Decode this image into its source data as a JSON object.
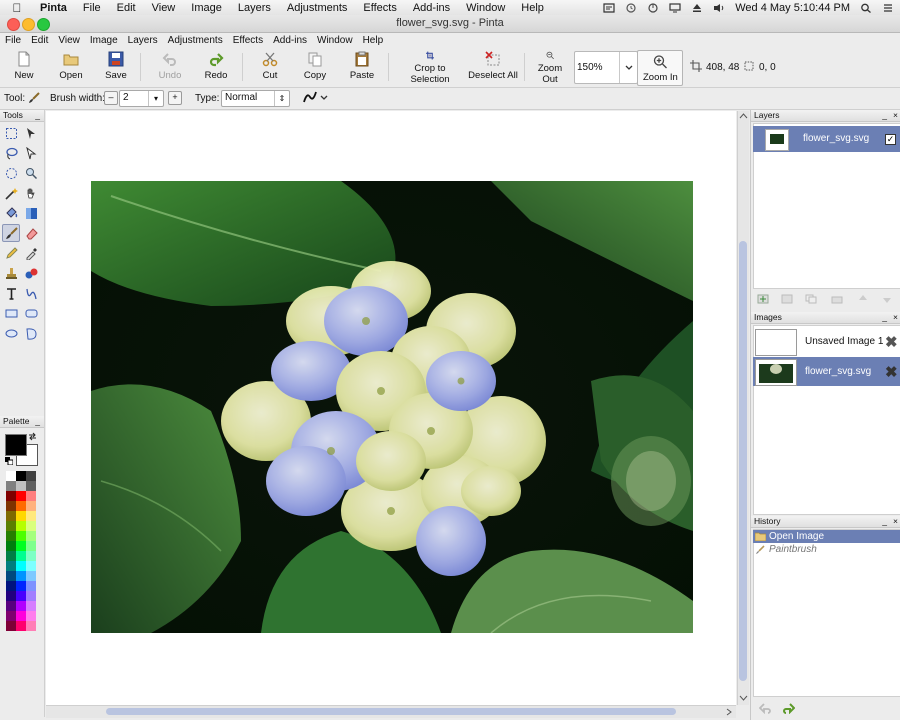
{
  "mac_menu": {
    "app": "Pinta",
    "items": [
      "File",
      "Edit",
      "View",
      "Image",
      "Layers",
      "Adjustments",
      "Effects",
      "Add-ins",
      "Window",
      "Help"
    ],
    "clock": "Wed 4 May  5:10:44 PM"
  },
  "window": {
    "title": "flower_svg.svg - Pinta"
  },
  "app_menu": [
    "File",
    "Edit",
    "View",
    "Image",
    "Layers",
    "Adjustments",
    "Effects",
    "Add-ins",
    "Window",
    "Help"
  ],
  "toolbar": {
    "new": "New",
    "open": "Open",
    "save": "Save",
    "undo": "Undo",
    "redo": "Redo",
    "cut": "Cut",
    "copy": "Copy",
    "paste": "Paste",
    "crop": "Crop to Selection",
    "deselect": "Deselect All",
    "zoom_out": "Zoom Out",
    "zoom_value": "150%",
    "zoom_in": "Zoom In",
    "cursor_pos": "408, 48",
    "selection_size": "0, 0"
  },
  "tool_options": {
    "tool_label": "Tool:",
    "brush_width_label": "Brush width:",
    "brush_width": "2",
    "minus": "–",
    "plus": "+",
    "type_label": "Type:",
    "type_value": "Normal"
  },
  "panels": {
    "tools": "Tools",
    "palette": "Palette",
    "layers": "Layers",
    "images": "Images",
    "history": "History",
    "minimize": "_",
    "close": "×"
  },
  "layers": [
    {
      "name": "flower_svg.svg",
      "visible": true
    }
  ],
  "images": [
    {
      "name": "Unsaved Image 1",
      "selected": false
    },
    {
      "name": "flower_svg.svg",
      "selected": true
    }
  ],
  "history": [
    {
      "name": "Open Image",
      "selected": true
    },
    {
      "name": "Paintbrush",
      "selected": false
    }
  ],
  "palette_colors": {
    "primary": "#000000",
    "secondary": "#ffffff",
    "swatches": [
      "#ffffff",
      "#000000",
      "#404040",
      "#808080",
      "#c0c0c0",
      "#606060",
      "#7f0000",
      "#ff0000",
      "#ff7f7f",
      "#7f3300",
      "#ff6a00",
      "#ffb27f",
      "#7f6a00",
      "#ffd800",
      "#ffe97f",
      "#5b7f00",
      "#b6ff00",
      "#daff7f",
      "#267f00",
      "#4cff00",
      "#a5ff7f",
      "#007f0e",
      "#00ff21",
      "#7fff8e",
      "#007f46",
      "#00ff90",
      "#7fffc5",
      "#007f7f",
      "#00ffff",
      "#7fffff",
      "#004a7f",
      "#0094ff",
      "#7fc9ff",
      "#00137f",
      "#0026ff",
      "#7f92ff",
      "#21007f",
      "#4800ff",
      "#a17fff",
      "#57007f",
      "#b200ff",
      "#d67fff",
      "#7f006e",
      "#ff00dc",
      "#ff7fed",
      "#7f0037",
      "#ff006e",
      "#ff7fb6"
    ]
  },
  "colors": {
    "selection": "#6b7fb4",
    "accent": "#4a66c8"
  }
}
